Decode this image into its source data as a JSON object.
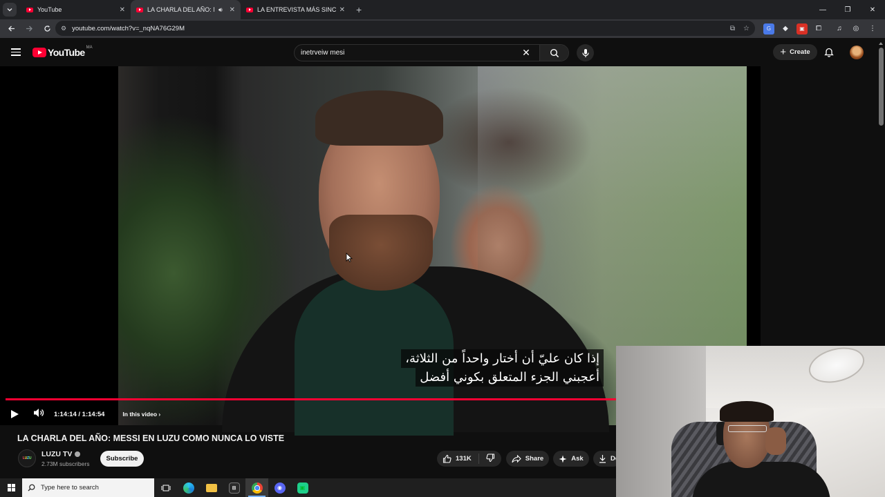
{
  "browser": {
    "tabs": [
      {
        "title": "YouTube",
        "active": false,
        "audio": false
      },
      {
        "title": "LA CHARLA DEL AÑO: MES",
        "active": true,
        "audio": true
      },
      {
        "title": "LA ENTREVISTA MÁS SINCERA",
        "active": false,
        "audio": false
      }
    ],
    "url": "youtube.com/watch?v=_nqNA76G29M"
  },
  "youtube": {
    "logo_text": "YouTube",
    "region": "MA",
    "search_query": "inetrveiw mesi",
    "create_label": "Create"
  },
  "player": {
    "subtitle_lines": [
      "إذا كان عليّ أن أختار واحداً من الثلاثة،",
      "أعجبني الجزء المتعلق بكوني أفضل"
    ],
    "time": "1:14:14 / 1:14:54",
    "chapters_label": "In this video",
    "progress_fraction": 0.99
  },
  "video": {
    "title": "LA CHARLA DEL AÑO: MESSI EN LUZU COMO NUNCA LO VISTE",
    "channel_name": "LUZU TV",
    "channel_logo_letters": [
      "L",
      "U",
      "Z",
      "U"
    ],
    "subscribers": "2.73M subscribers",
    "subscribe_label": "Subscribe",
    "likes": "131K",
    "share_label": "Share",
    "ask_label": "Ask",
    "download_label": "Do"
  },
  "taskbar": {
    "search_placeholder": "Type here to search"
  },
  "colors": {
    "youtube_red": "#ff0033",
    "page_bg": "#0f0f0f",
    "chrome_bg": "#202124"
  }
}
